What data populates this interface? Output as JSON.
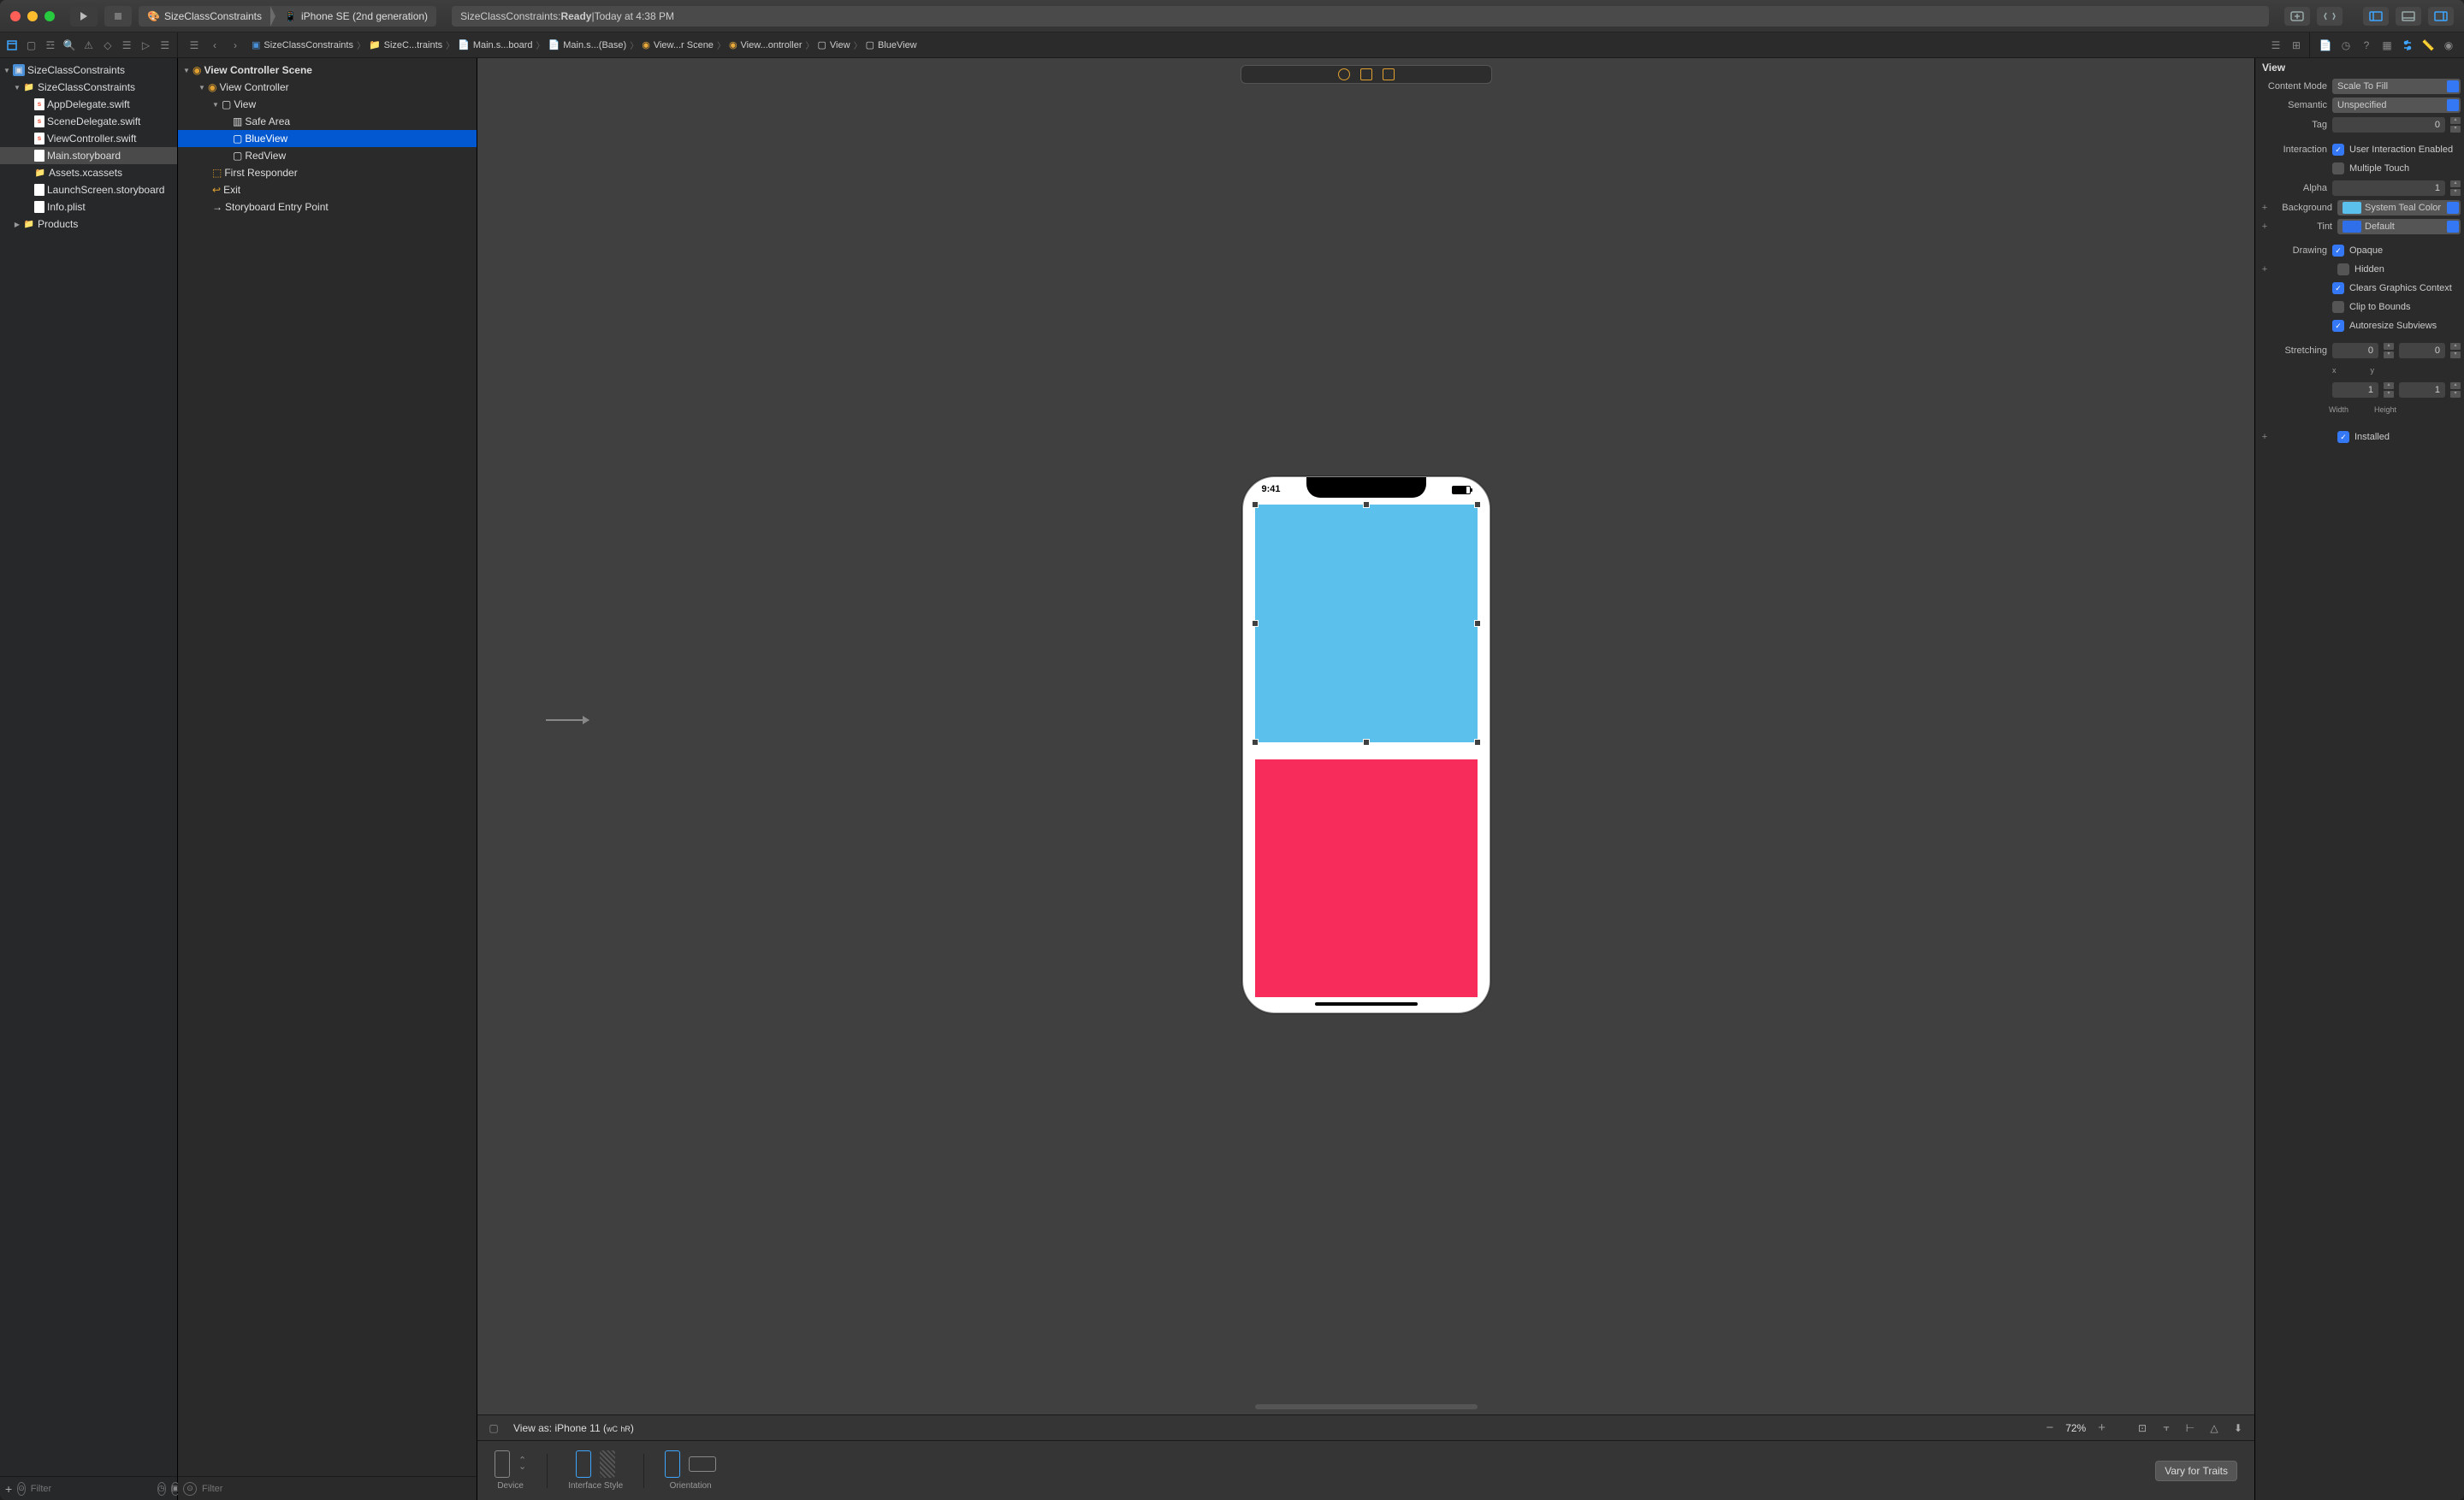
{
  "titlebar": {
    "scheme_name": "SizeClassConstraints",
    "scheme_device": "iPhone SE (2nd generation)",
    "status_prefix": "SizeClassConstraints: ",
    "status_state": "Ready",
    "status_sep": " | ",
    "status_time": "Today at 4:38 PM"
  },
  "jumpbar": {
    "items": [
      "SizeClassConstraints",
      "SizeC...traints",
      "Main.s...board",
      "Main.s...(Base)",
      "View...r Scene",
      "View...ontroller",
      "View",
      "BlueView"
    ]
  },
  "navigator": {
    "project": "SizeClassConstraints",
    "group": "SizeClassConstraints",
    "files": [
      "AppDelegate.swift",
      "SceneDelegate.swift",
      "ViewController.swift",
      "Main.storyboard",
      "Assets.xcassets",
      "LaunchScreen.storyboard",
      "Info.plist"
    ],
    "products": "Products",
    "filter_placeholder": "Filter"
  },
  "outline": {
    "scene": "View Controller Scene",
    "vc": "View Controller",
    "view": "View",
    "safe": "Safe Area",
    "blue": "BlueView",
    "red": "RedView",
    "first": "First Responder",
    "exit": "Exit",
    "entry": "Storyboard Entry Point",
    "filter_placeholder": "Filter"
  },
  "canvas": {
    "time": "9:41",
    "viewas": "View as: iPhone 11 (",
    "wc": "wC",
    "hr": "hR",
    "close": ")",
    "zoom": "72%",
    "device_label": "Device",
    "ifs_label": "Interface Style",
    "orient_label": "Orientation",
    "vary": "Vary for Traits"
  },
  "inspector": {
    "section": "View",
    "content_mode_l": "Content Mode",
    "content_mode": "Scale To Fill",
    "semantic_l": "Semantic",
    "semantic": "Unspecified",
    "tag_l": "Tag",
    "tag": "0",
    "interaction_l": "Interaction",
    "uie": "User Interaction Enabled",
    "mt": "Multiple Touch",
    "alpha_l": "Alpha",
    "alpha": "1",
    "bg_l": "Background",
    "bg": "System Teal Color",
    "tint_l": "Tint",
    "tint": "Default",
    "drawing_l": "Drawing",
    "opaque": "Opaque",
    "hidden": "Hidden",
    "clears": "Clears Graphics Context",
    "clip": "Clip to Bounds",
    "auto": "Autoresize Subviews",
    "stretch_l": "Stretching",
    "s0": "0",
    "s1": "1",
    "x": "x",
    "y": "y",
    "w": "Width",
    "h": "Height",
    "installed": "Installed"
  }
}
